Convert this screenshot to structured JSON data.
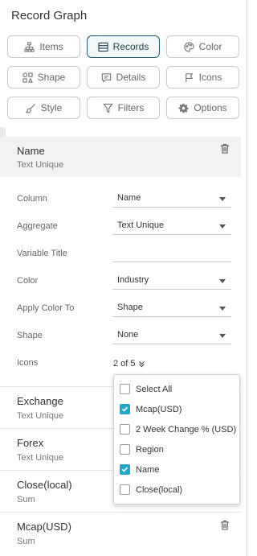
{
  "panel": {
    "title": "Record Graph"
  },
  "tabs": [
    {
      "label": "Items",
      "icon": "hierarchy-icon",
      "active": false
    },
    {
      "label": "Records",
      "icon": "records-icon",
      "active": true
    },
    {
      "label": "Color",
      "icon": "palette-icon",
      "active": false
    },
    {
      "label": "Shape",
      "icon": "shape-icon",
      "active": false
    },
    {
      "label": "Details",
      "icon": "details-icon",
      "active": false
    },
    {
      "label": "Icons",
      "icon": "flag-icon",
      "active": false
    },
    {
      "label": "Style",
      "icon": "brush-icon",
      "active": false
    },
    {
      "label": "Filters",
      "icon": "filter-icon",
      "active": false
    },
    {
      "label": "Options",
      "icon": "gear-icon",
      "active": false
    }
  ],
  "selected_record": {
    "name": "Name",
    "aggregate_label": "Text Unique"
  },
  "settings": {
    "column": {
      "label": "Column",
      "value": "Name"
    },
    "aggregate": {
      "label": "Aggregate",
      "value": "Text Unique"
    },
    "variable_title": {
      "label": "Variable Title",
      "value": ""
    },
    "color": {
      "label": "Color",
      "value": "Industry"
    },
    "apply_color_to": {
      "label": "Apply Color To",
      "value": "Shape"
    },
    "shape": {
      "label": "Shape",
      "value": "None"
    },
    "icons": {
      "label": "Icons",
      "value": "2 of 5"
    }
  },
  "records": [
    {
      "name": "Exchange",
      "aggregate": "Text Unique"
    },
    {
      "name": "Forex",
      "aggregate": "Text Unique"
    },
    {
      "name": "Close(local)",
      "aggregate": "Sum"
    },
    {
      "name": "Mcap(USD)",
      "aggregate": "Sum"
    }
  ],
  "icons_dropdown": {
    "options": [
      {
        "label": "Select All",
        "checked": false
      },
      {
        "label": "Mcap(USD)",
        "checked": true
      },
      {
        "label": "2 Week Change % (USD)",
        "checked": false
      },
      {
        "label": "Region",
        "checked": false
      },
      {
        "label": "Name",
        "checked": true
      },
      {
        "label": "Close(local)",
        "checked": false
      }
    ]
  },
  "colors": {
    "accent": "#22a8c7",
    "active_tab_border": "#1f5b6e"
  }
}
